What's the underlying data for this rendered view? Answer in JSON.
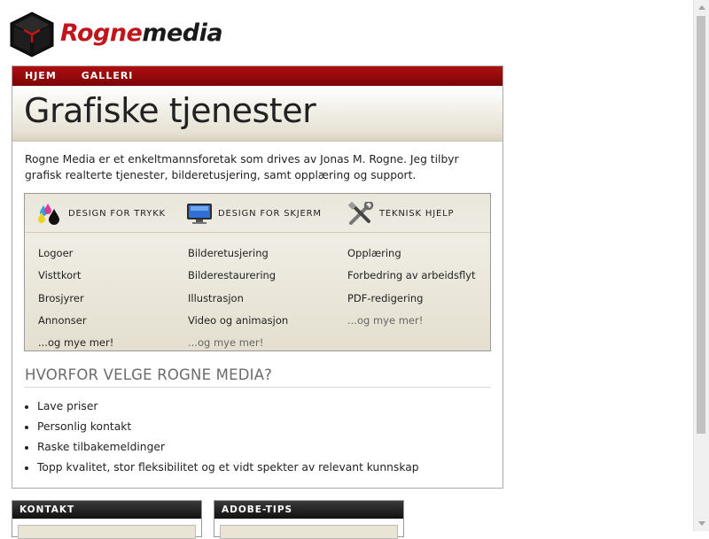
{
  "logo": {
    "part1": "Rogne",
    "part2": "media"
  },
  "nav": {
    "items": [
      "HJEM",
      "GALLERI"
    ]
  },
  "page": {
    "title": "Grafiske tjenester",
    "intro": "Rogne Media er et enkeltmannsforetak som drives av Jonas M. Rogne. Jeg tilbyr grafisk realterte tjenester, bilderetusjering, samt opplæring og support."
  },
  "services": {
    "columns": [
      {
        "heading": "DESIGN FOR TRYKK",
        "icon": "ink-drops-icon",
        "items": [
          "Logoer",
          "Visttkort",
          "Brosjyrer",
          "Annonser"
        ],
        "more": "...og mye mer!"
      },
      {
        "heading": "DESIGN FOR SKJERM",
        "icon": "monitor-icon",
        "items": [
          "Bilderetusjering",
          "Bilderestaurering",
          "Illustrasjon",
          "Video og animasjon"
        ],
        "more": "...og mye mer!"
      },
      {
        "heading": "TEKNISK HJELP",
        "icon": "tools-icon",
        "items": [
          "Opplæring",
          "Forbedring av arbeidsflyt",
          "PDF-redigering"
        ],
        "more": "...og mye mer!"
      }
    ]
  },
  "why": {
    "heading": "HVORFOR VELGE ROGNE MEDIA?",
    "items": [
      "Lave priser",
      "Personlig kontakt",
      "Raske tilbakemeldinger",
      "Topp kvalitet, stor fleksibilitet og et vidt spekter av relevant kunnskap"
    ]
  },
  "panels": {
    "contact": "KONTAKT",
    "adobe": "ADOBE-TIPS"
  },
  "colors": {
    "brand_red": "#c0161b",
    "nav_red": "#9c0a0d",
    "beige": "#e6e1d3"
  }
}
